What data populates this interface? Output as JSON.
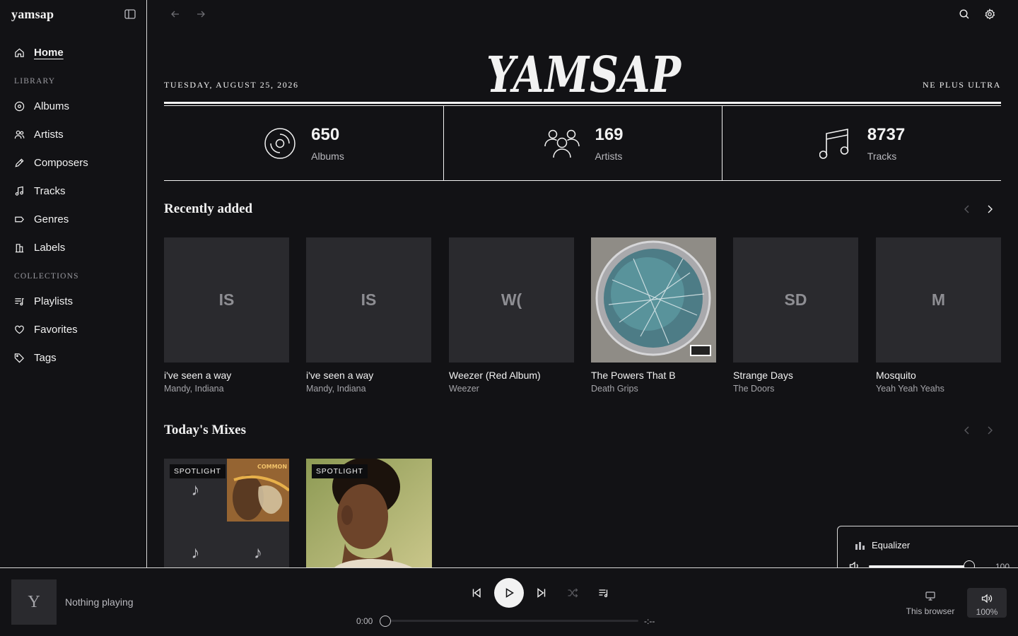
{
  "app": {
    "brand": "yamsap"
  },
  "nav": {
    "home": "Home",
    "library_label": "LIBRARY",
    "library": [
      "Albums",
      "Artists",
      "Composers",
      "Tracks",
      "Genres",
      "Labels"
    ],
    "collections_label": "COLLECTIONS",
    "collections": [
      "Playlists",
      "Favorites",
      "Tags"
    ]
  },
  "masthead": {
    "date": "TUESDAY, AUGUST 25, 2026",
    "logo": "YAMSAP",
    "motto": "NE PLUS ULTRA"
  },
  "stats": [
    {
      "value": "650",
      "label": "Albums",
      "icon": "vinyl-icon"
    },
    {
      "value": "169",
      "label": "Artists",
      "icon": "people-icon"
    },
    {
      "value": "8737",
      "label": "Tracks",
      "icon": "music-note-icon"
    }
  ],
  "recently_added": {
    "title": "Recently added",
    "items": [
      {
        "initials": "IS",
        "title": "i've seen a way",
        "artist": "Mandy, Indiana"
      },
      {
        "initials": "IS",
        "title": "i've seen a way",
        "artist": "Mandy, Indiana"
      },
      {
        "initials": "W(",
        "title": "Weezer (Red Album)",
        "artist": "Weezer"
      },
      {
        "initials": "",
        "title": "The Powers That B",
        "artist": "Death Grips"
      },
      {
        "initials": "SD",
        "title": "Strange Days",
        "artist": "The Doors"
      },
      {
        "initials": "M",
        "title": "Mosquito",
        "artist": "Yeah Yeah Yeahs"
      }
    ]
  },
  "mixes": {
    "title": "Today's Mixes",
    "badge": "SPOTLIGHT",
    "note_glyph": "♪",
    "album_text": "COMMON"
  },
  "equalizer": {
    "title": "Equalizer",
    "volume": "100",
    "level": 1.0
  },
  "player": {
    "art_initial": "Y",
    "now_playing": "Nothing playing",
    "time_current": "0:00",
    "time_total": "-:--",
    "progress": 0,
    "device": "This browser",
    "volume": "100%"
  },
  "colors": {
    "background": "#121215",
    "foreground": "#f2f2f2",
    "tile": "#2a2a2e",
    "muted": "#a5a5aa"
  }
}
